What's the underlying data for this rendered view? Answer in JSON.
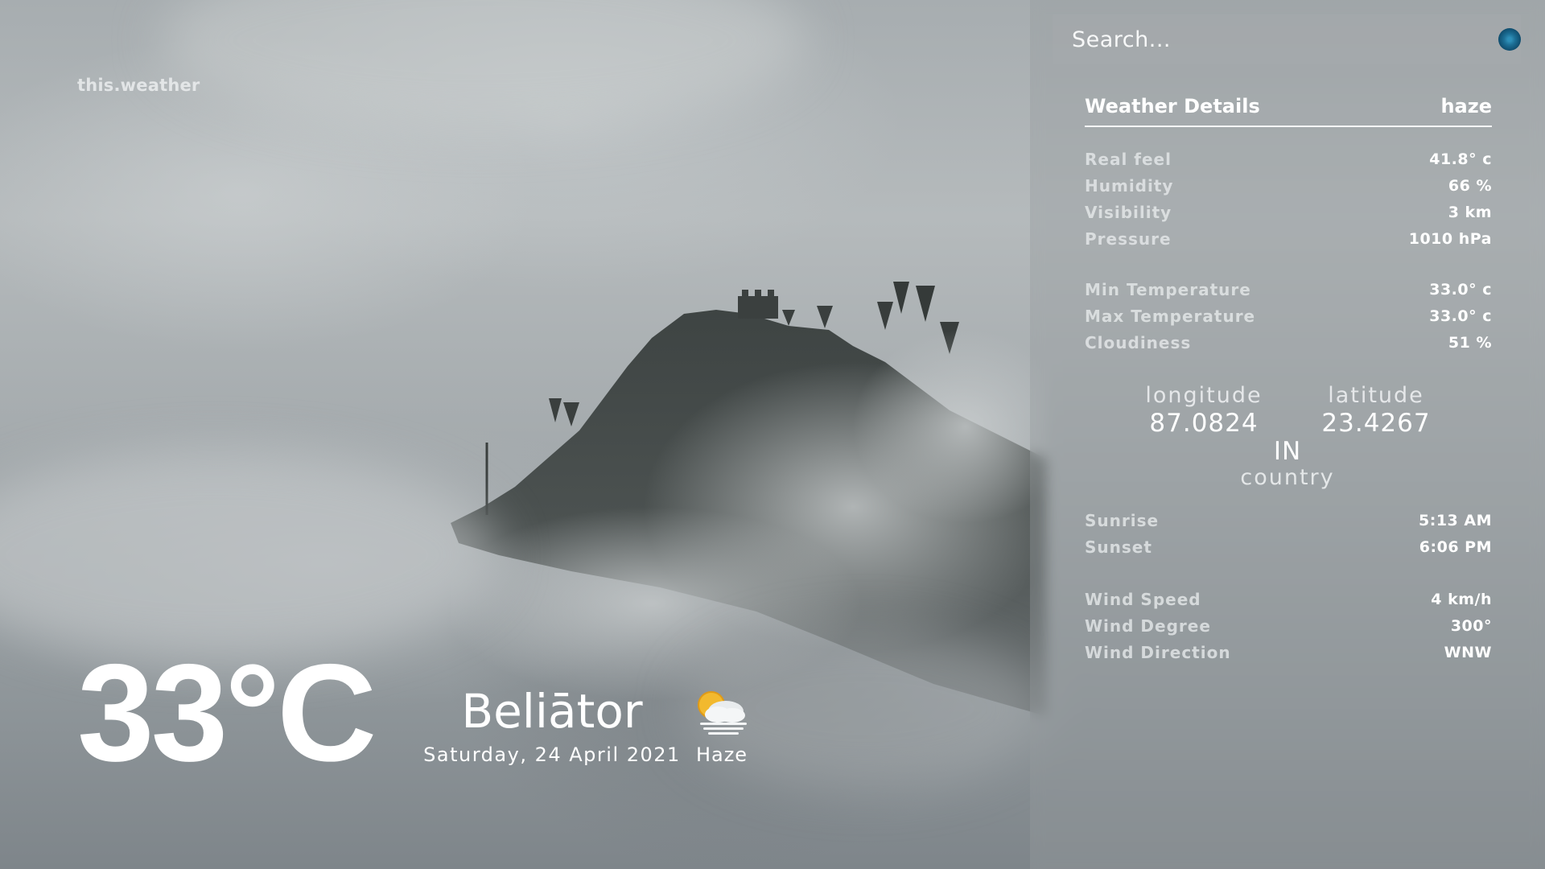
{
  "brand": "this.weather",
  "current": {
    "temperature": "33°C",
    "city": "Beliātor",
    "date": "Saturday, 24 April 2021",
    "condition": "Haze",
    "condition_icon": "sun-behind-haze-icon"
  },
  "search": {
    "placeholder": "Search...",
    "button_icon": "search-icon",
    "button_color": "#1c6f96"
  },
  "details": {
    "title": "Weather Details",
    "summary": "haze",
    "group1": [
      {
        "label": "Real feel",
        "value": "41.8° c"
      },
      {
        "label": "Humidity",
        "value": "66 %"
      },
      {
        "label": "Visibility",
        "value": "3 km"
      },
      {
        "label": "Pressure",
        "value": "1010 hPa"
      }
    ],
    "group2": [
      {
        "label": "Min Temperature",
        "value": "33.0° c"
      },
      {
        "label": "Max Temperature",
        "value": "33.0° c"
      },
      {
        "label": "Cloudiness",
        "value": "51 %"
      }
    ],
    "location": {
      "longitude_label": "longitude",
      "longitude": "87.0824",
      "latitude_label": "latitude",
      "latitude": "23.4267",
      "country_code": "IN",
      "country_label": "country"
    },
    "group3": [
      {
        "label": "Sunrise",
        "value": "5:13 AM"
      },
      {
        "label": "Sunset",
        "value": "6:06 PM"
      }
    ],
    "group4": [
      {
        "label": "Wind Speed",
        "value": "4 km/h"
      },
      {
        "label": "Wind Degree",
        "value": "300°"
      },
      {
        "label": "Wind Direction",
        "value": "WNW"
      }
    ]
  }
}
